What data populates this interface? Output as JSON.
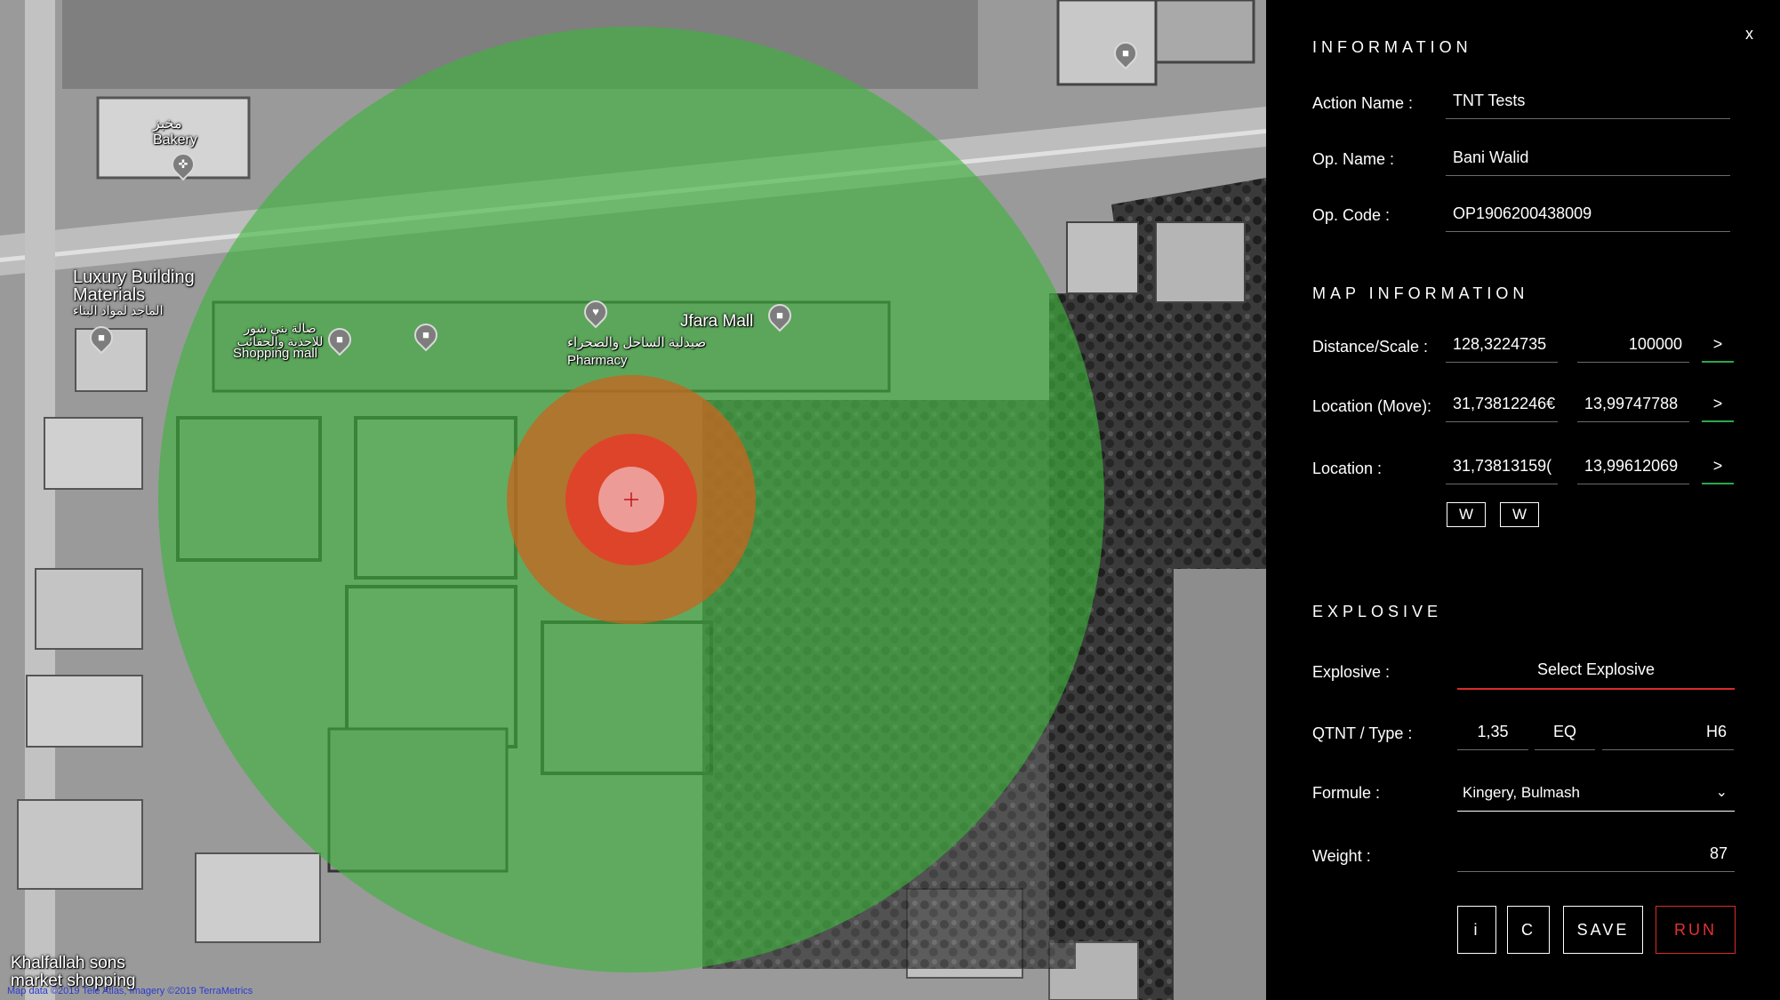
{
  "map": {
    "labels": {
      "bakery_ar": "مخبز",
      "bakery": "Bakery",
      "luxury_line1": "Luxury Building",
      "luxury_line2": "Materials",
      "luxury_ar": "الماجد لمواد البناء",
      "shopping_ar": "صالة بني شور للاحذية والحقائب",
      "shopping": "Shopping mall",
      "jfara": "Jfara Mall",
      "pharmacy_ar": "صيدلية الساحل والصحراء",
      "pharmacy": "Pharmacy",
      "khalfallah_line1": "Khalfallah sons",
      "khalfallah_line2": "market shopping"
    },
    "copyright": "Map data ©2019 Tele Atlas, Imagery ©2019 TerraMetrics",
    "zone_colors": {
      "outer": "#3cb43c",
      "middle": "#c8641e",
      "inner": "#e63c28",
      "core": "#f0aaaa"
    }
  },
  "panel": {
    "close": "x",
    "information": {
      "title": "INFORMATION",
      "action_name_label": "Action Name :",
      "action_name": "TNT Tests",
      "op_name_label": "Op. Name :",
      "op_name": "Bani Walid",
      "op_code_label": "Op. Code :",
      "op_code": "OP1906200438009"
    },
    "map_information": {
      "title": "MAP INFORMATION",
      "distance_label": "Distance/Scale :",
      "distance": "128,3224735",
      "scale": "100000",
      "location_move_label": "Location (Move):",
      "move_lat": "31,73812246€",
      "move_lon": "13,99747788",
      "location_label": "Location :",
      "loc_lat": "31,73813159(",
      "loc_lon": "13,99612069",
      "go": ">",
      "w1": "W",
      "w2": "W"
    },
    "explosive": {
      "title": "EXPLOSIVE",
      "explosive_label": "Explosive :",
      "explosive_value": "Select Explosive",
      "qtnt_label": "QTNT / Type :",
      "qtnt": "1,35",
      "type": "EQ",
      "type2": "H6",
      "formule_label": "Formule :",
      "formule": "Kingery, Bulmash",
      "weight_label": "Weight :",
      "weight": "87"
    },
    "buttons": {
      "info": "i",
      "clear": "C",
      "save": "SAVE",
      "run": "RUN"
    }
  }
}
